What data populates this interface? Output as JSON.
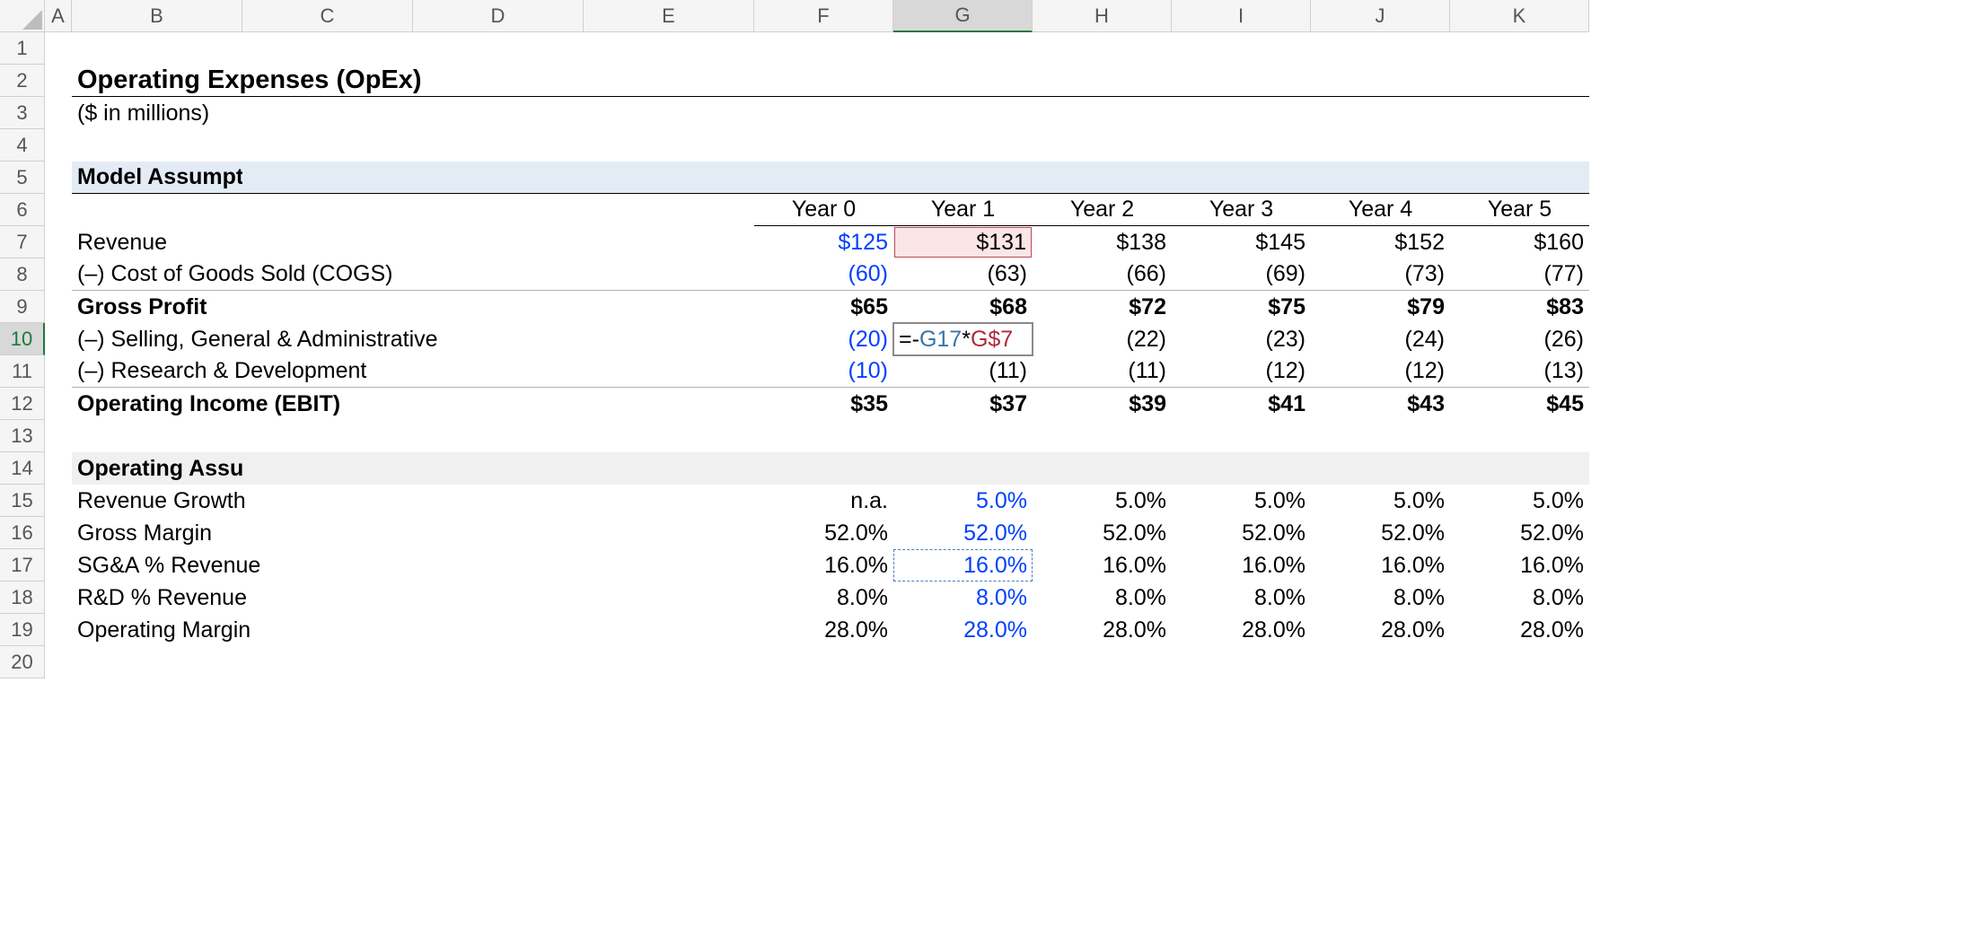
{
  "columns": [
    "A",
    "B",
    "C",
    "D",
    "E",
    "F",
    "G",
    "H",
    "I",
    "J",
    "K"
  ],
  "rowCount": 20,
  "selectedCol": "G",
  "selectedRow": 10,
  "title": "Operating Expenses (OpEx)",
  "subtitle": "($ in millions)",
  "section1": "Model Assumptions",
  "yearLabels": [
    "Year 0",
    "Year 1",
    "Year 2",
    "Year 3",
    "Year 4",
    "Year 5"
  ],
  "rows": {
    "revenue": {
      "label": "Revenue",
      "values": [
        "$125",
        "$131",
        "$138",
        "$145",
        "$152",
        "$160"
      ]
    },
    "cogs": {
      "label": "(–) Cost of Goods Sold (COGS)",
      "values": [
        "(60)",
        "(63)",
        "(66)",
        "(69)",
        "(73)",
        "(77)"
      ]
    },
    "gp": {
      "label": "Gross Profit",
      "values": [
        "$65",
        "$68",
        "$72",
        "$75",
        "$79",
        "$83"
      ]
    },
    "sga": {
      "label": "(–) Selling, General & Administrative",
      "values": [
        "(20)",
        "",
        "(22)",
        "(23)",
        "(24)",
        "(26)"
      ]
    },
    "rnd": {
      "label": "(–) Research & Development",
      "values": [
        "(10)",
        "(11)",
        "(11)",
        "(12)",
        "(12)",
        "(13)"
      ]
    },
    "ebit": {
      "label": "Operating Income (EBIT)",
      "values": [
        "$35",
        "$37",
        "$39",
        "$41",
        "$43",
        "$45"
      ]
    }
  },
  "section2": "Operating Assumptions",
  "assumptions": {
    "revGrowth": {
      "label": "Revenue Growth",
      "values": [
        "n.a.",
        "5.0%",
        "5.0%",
        "5.0%",
        "5.0%",
        "5.0%"
      ]
    },
    "gm": {
      "label": "Gross Margin",
      "values": [
        "52.0%",
        "52.0%",
        "52.0%",
        "52.0%",
        "52.0%",
        "52.0%"
      ]
    },
    "sgaPct": {
      "label": "SG&A % Revenue",
      "values": [
        "16.0%",
        "16.0%",
        "16.0%",
        "16.0%",
        "16.0%",
        "16.0%"
      ]
    },
    "rndPct": {
      "label": "R&D % Revenue",
      "values": [
        "8.0%",
        "8.0%",
        "8.0%",
        "8.0%",
        "8.0%",
        "8.0%"
      ]
    },
    "opMargin": {
      "label": "Operating Margin",
      "values": [
        "28.0%",
        "28.0%",
        "28.0%",
        "28.0%",
        "28.0%",
        "28.0%"
      ]
    }
  },
  "formula": {
    "prefix": "=-",
    "ref1": "G17",
    "op": "*",
    "ref2": "G$7"
  },
  "chart_data": {
    "type": "table",
    "title": "Operating Expenses (OpEx) ($ in millions)",
    "categories": [
      "Year 0",
      "Year 1",
      "Year 2",
      "Year 3",
      "Year 4",
      "Year 5"
    ],
    "series": [
      {
        "name": "Revenue",
        "values": [
          125,
          131,
          138,
          145,
          152,
          160
        ]
      },
      {
        "name": "COGS",
        "values": [
          -60,
          -63,
          -66,
          -69,
          -73,
          -77
        ]
      },
      {
        "name": "Gross Profit",
        "values": [
          65,
          68,
          72,
          75,
          79,
          83
        ]
      },
      {
        "name": "SG&A",
        "values": [
          -20,
          null,
          -22,
          -23,
          -24,
          -26
        ]
      },
      {
        "name": "R&D",
        "values": [
          -10,
          -11,
          -11,
          -12,
          -12,
          -13
        ]
      },
      {
        "name": "Operating Income (EBIT)",
        "values": [
          35,
          37,
          39,
          41,
          43,
          45
        ]
      },
      {
        "name": "Revenue Growth %",
        "values": [
          null,
          5.0,
          5.0,
          5.0,
          5.0,
          5.0
        ]
      },
      {
        "name": "Gross Margin %",
        "values": [
          52.0,
          52.0,
          52.0,
          52.0,
          52.0,
          52.0
        ]
      },
      {
        "name": "SG&A % Revenue",
        "values": [
          16.0,
          16.0,
          16.0,
          16.0,
          16.0,
          16.0
        ]
      },
      {
        "name": "R&D % Revenue",
        "values": [
          8.0,
          8.0,
          8.0,
          8.0,
          8.0,
          8.0
        ]
      },
      {
        "name": "Operating Margin %",
        "values": [
          28.0,
          28.0,
          28.0,
          28.0,
          28.0,
          28.0
        ]
      }
    ]
  }
}
